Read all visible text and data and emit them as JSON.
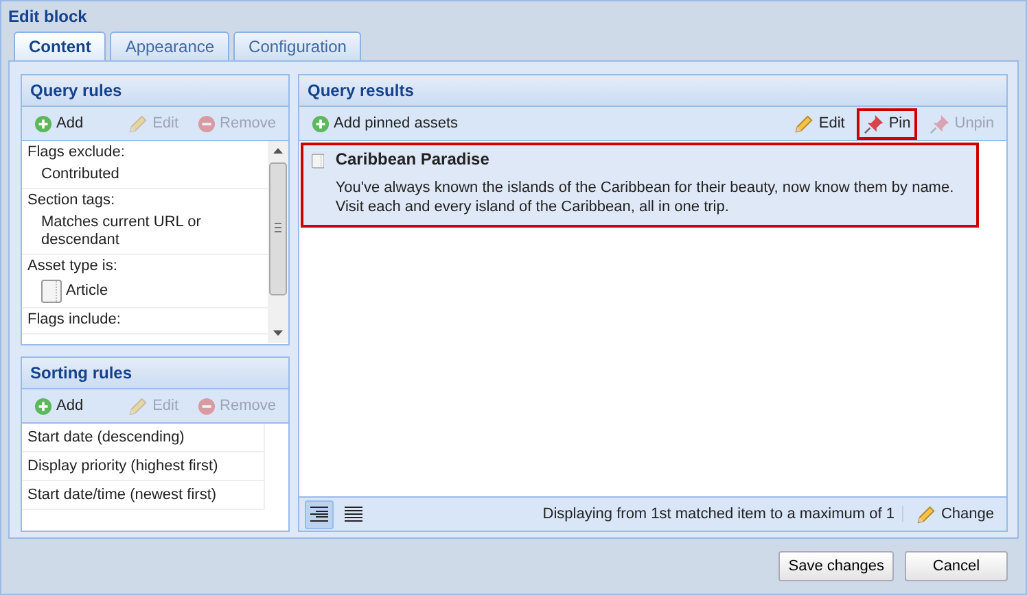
{
  "window": {
    "title": "Edit block"
  },
  "tabs": [
    {
      "label": "Content",
      "selected": true
    },
    {
      "label": "Appearance",
      "selected": false
    },
    {
      "label": "Configuration",
      "selected": false
    }
  ],
  "query_rules": {
    "title": "Query rules",
    "toolbar": [
      {
        "kind": "add",
        "label": "Add",
        "disabled": false
      },
      {
        "kind": "edit",
        "label": "Edit",
        "disabled": true
      },
      {
        "kind": "remove",
        "label": "Remove",
        "disabled": true
      }
    ],
    "rules": [
      {
        "label": "Flags exclude:",
        "values": [
          {
            "text": "Contributed"
          }
        ]
      },
      {
        "label": "Section tags:",
        "values": [
          {
            "text": "Matches current URL or descendant"
          }
        ]
      },
      {
        "label": "Asset type is:",
        "values": [
          {
            "text": "Article",
            "kind": "asset"
          }
        ]
      },
      {
        "label": "Flags include:"
      }
    ]
  },
  "sorting_rules": {
    "title": "Sorting rules",
    "toolbar": [
      {
        "kind": "add",
        "label": "Add",
        "disabled": false
      },
      {
        "kind": "edit",
        "label": "Edit",
        "disabled": true
      },
      {
        "kind": "remove",
        "label": "Remove",
        "disabled": true
      }
    ],
    "rows": [
      "Start date (descending)",
      "Display priority (highest first)",
      "Start date/time (newest first)"
    ]
  },
  "query_results": {
    "title": "Query results",
    "add_button": "Add pinned assets",
    "toolbar": [
      {
        "kind": "edit",
        "label": "Edit",
        "disabled": false,
        "highlighted": false
      },
      {
        "kind": "pin",
        "label": "Pin",
        "disabled": false,
        "highlighted": true
      },
      {
        "kind": "pin",
        "label": "Unpin",
        "disabled": true,
        "highlighted": false
      }
    ],
    "items": [
      {
        "title": "Caribbean Paradise",
        "description": "You've always known the islands of the Caribbean for their beauty, now know them by name.  Visit each and every island of the Caribbean, all in one trip.",
        "selected": true
      }
    ],
    "views": [
      {
        "kind": "summary",
        "selected": true
      },
      {
        "kind": "list",
        "selected": false
      }
    ],
    "status": "Displaying from 1st matched item to a maximum of 1",
    "change_button": "Change"
  },
  "buttons": [
    "Save changes",
    "Cancel"
  ]
}
